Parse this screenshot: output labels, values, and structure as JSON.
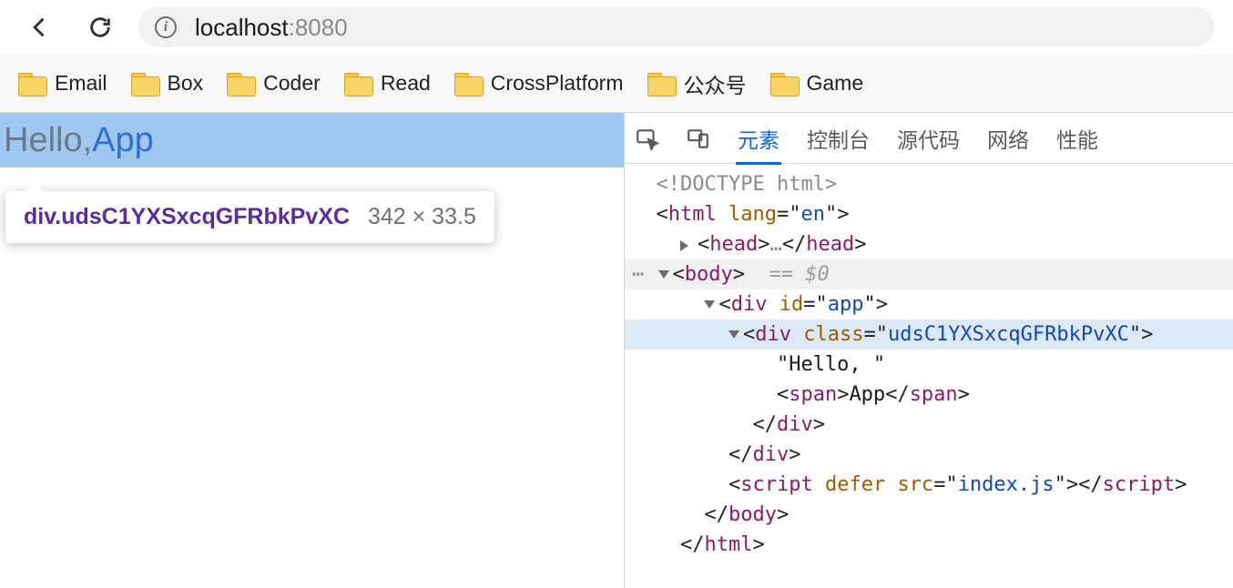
{
  "toolbar": {
    "url_host": "localhost",
    "url_port": ":8080"
  },
  "bookmarks": [
    {
      "label": "Email"
    },
    {
      "label": "Box"
    },
    {
      "label": "Coder"
    },
    {
      "label": "Read"
    },
    {
      "label": "CrossPlatform"
    },
    {
      "label": "公众号"
    },
    {
      "label": "Game"
    }
  ],
  "page": {
    "hello_text": "Hello, ",
    "app_text": "App"
  },
  "tooltip": {
    "selector_tag": "div",
    "selector_class": ".udsC1YXSxcqGFRbkPvXC",
    "dimensions": "342 × 33.5"
  },
  "devtools": {
    "tabs": {
      "elements": "元素",
      "console": "控制台",
      "sources": "源代码",
      "network": "网络",
      "performance": "性能"
    },
    "dom": {
      "doctype": "<!DOCTYPE html>",
      "html_open_lang_attr": "lang",
      "html_open_lang_val": "en",
      "head_open": "head",
      "head_ellipsis": "…",
      "body_open": "body",
      "body_eq": "== $0",
      "dots": "⋯",
      "div_app_id_attr": "id",
      "div_app_id_val": "app",
      "div_class_attr": "class",
      "div_class_val": "udsC1YXSxcqGFRbkPvXC",
      "text_hello": "\"Hello, \"",
      "span_tag": "span",
      "span_text": "App",
      "div_close": "div",
      "script_tag": "script",
      "script_defer": "defer",
      "script_src_attr": "src",
      "script_src_val": "index.js",
      "body_close": "body",
      "html_close": "html"
    }
  }
}
